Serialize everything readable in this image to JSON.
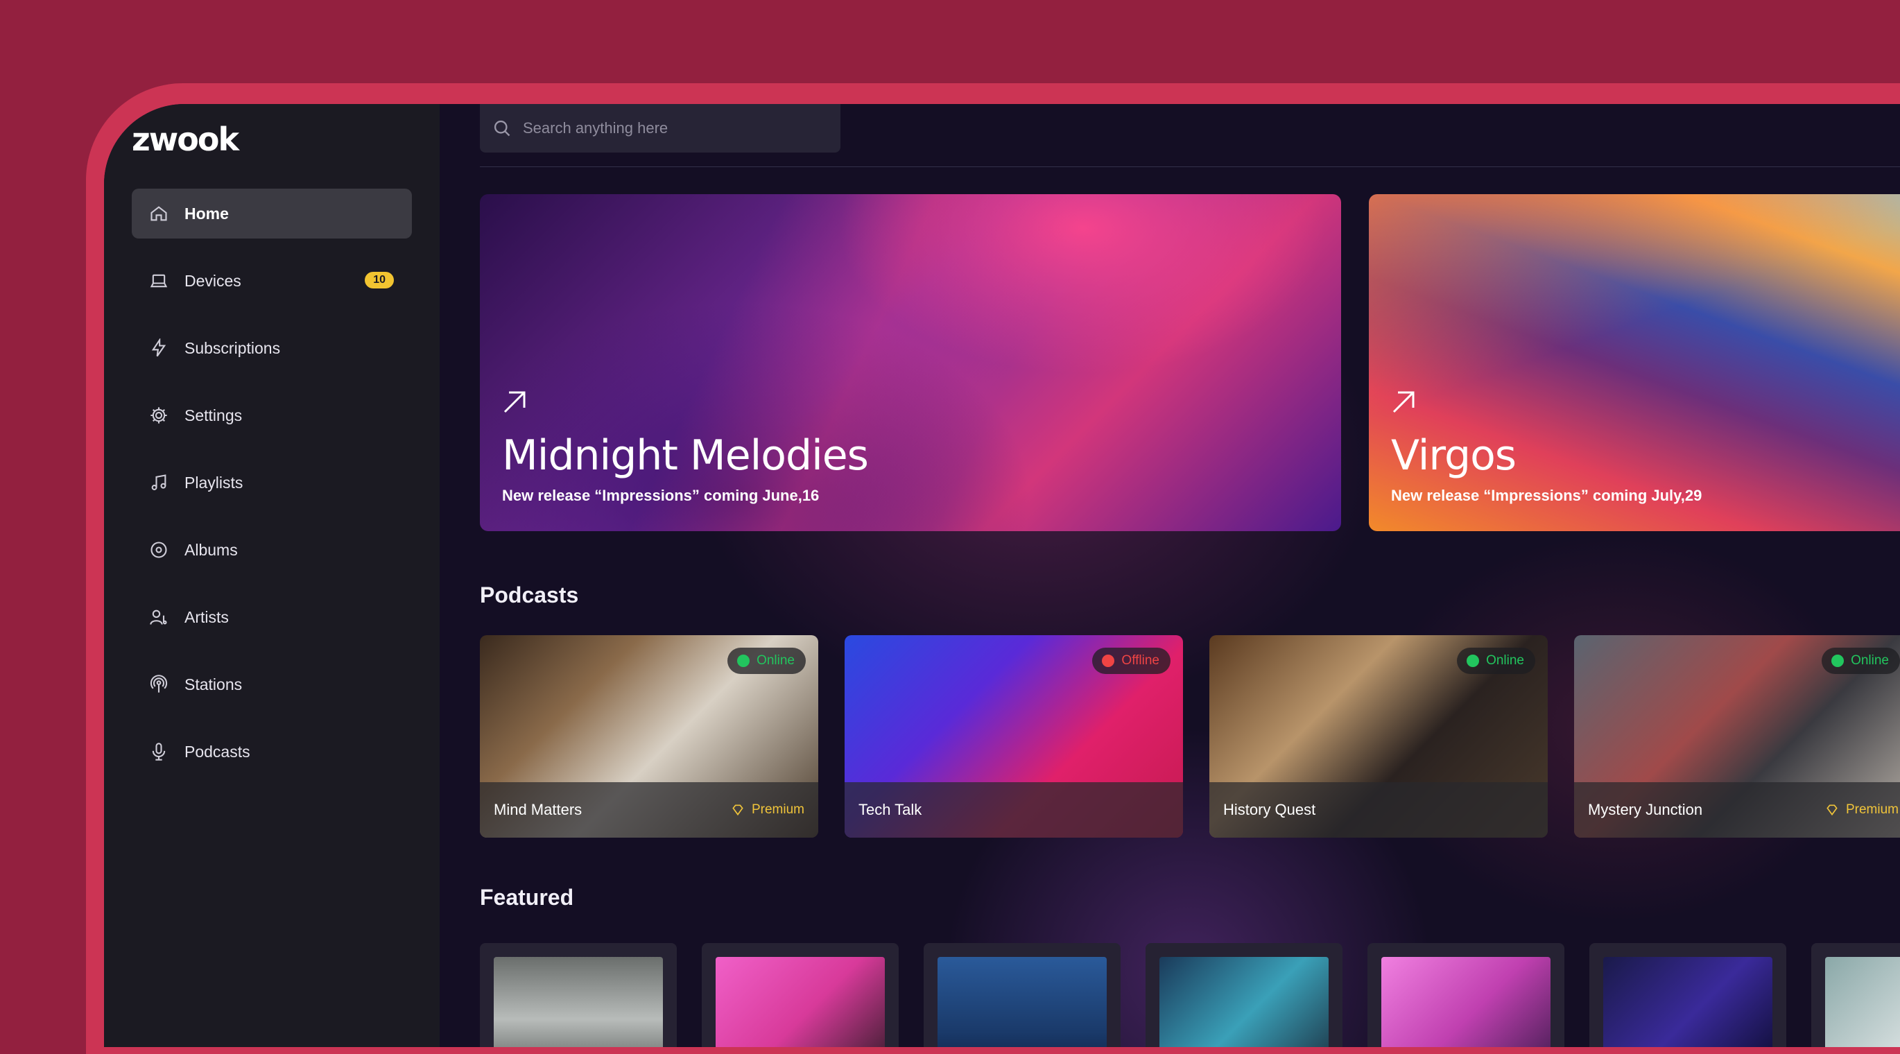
{
  "app": {
    "logo": "zwook"
  },
  "search": {
    "placeholder": "Search anything here"
  },
  "sidebar": {
    "items": [
      {
        "label": "Home",
        "icon": "home-icon",
        "active": true
      },
      {
        "label": "Devices",
        "icon": "laptop-icon",
        "badge": "10"
      },
      {
        "label": "Subscriptions",
        "icon": "lightning-icon"
      },
      {
        "label": "Settings",
        "icon": "gear-icon"
      },
      {
        "label": "Playlists",
        "icon": "music-note-icon"
      },
      {
        "label": "Albums",
        "icon": "disc-icon"
      },
      {
        "label": "Artists",
        "icon": "artist-icon"
      },
      {
        "label": "Stations",
        "icon": "radio-icon"
      },
      {
        "label": "Podcasts",
        "icon": "microphone-icon"
      }
    ]
  },
  "hero": [
    {
      "title": "Midnight Melodies",
      "subtitle": "New release “Impressions” coming June,16"
    },
    {
      "title": "Virgos",
      "subtitle": "New release “Impressions” coming July,29"
    }
  ],
  "sections": {
    "podcasts": "Podcasts",
    "featured": "Featured"
  },
  "podcasts": [
    {
      "title": "Mind Matters",
      "status": "Online",
      "premium": "Premium"
    },
    {
      "title": "Tech Talk",
      "status": "Offline"
    },
    {
      "title": "History Quest",
      "status": "Online"
    },
    {
      "title": "Mystery Junction",
      "status": "Online",
      "premium": "Premium"
    }
  ],
  "colors": {
    "online": "#22c55e",
    "offline": "#ef4444",
    "premium": "#f0c43a",
    "badge": "#f2c431",
    "frame": "#cc3454"
  }
}
